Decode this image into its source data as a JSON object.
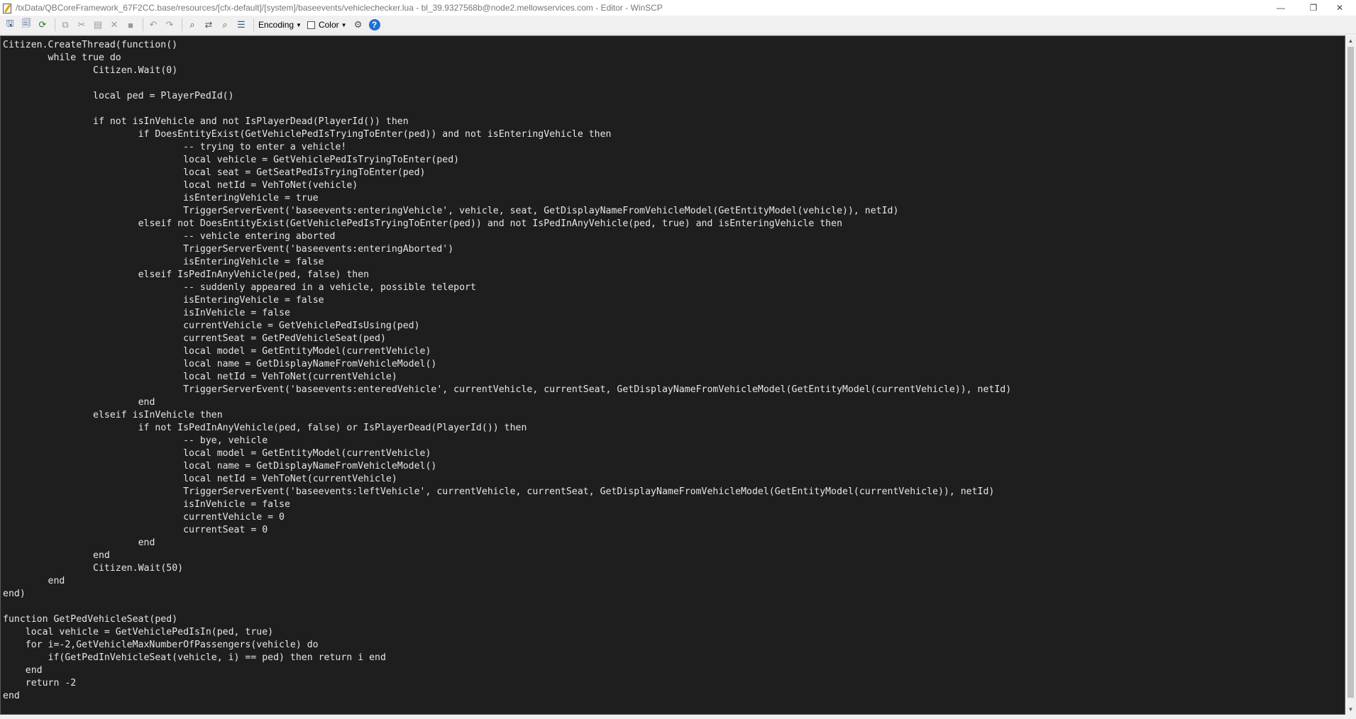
{
  "window": {
    "title": "/txData/QBCoreFramework_67F2CC.base/resources/[cfx-default]/[system]/baseevents/vehiclechecker.lua - bl_39.9327568b@node2.mellowservices.com - Editor - WinSCP",
    "minimize_glyph": "—",
    "restore_glyph": "❐",
    "close_glyph": "✕"
  },
  "toolbar": {
    "encoding_label": "Encoding",
    "color_label": "Color",
    "help_label": "?",
    "icons": [
      "save-icon",
      "save-all-icon",
      "reload-icon",
      "copy-icon",
      "cut-icon",
      "paste-icon",
      "delete-icon",
      "select-all-icon",
      "undo-icon",
      "redo-icon",
      "find-icon",
      "replace-icon",
      "find-next-icon",
      "goto-line-icon",
      "settings-icon",
      "help-icon"
    ]
  },
  "editor": {
    "content": "Citizen.CreateThread(function()\n\twhile true do\n\t\tCitizen.Wait(0)\n\n\t\tlocal ped = PlayerPedId()\n\n\t\tif not isInVehicle and not IsPlayerDead(PlayerId()) then\n\t\t\tif DoesEntityExist(GetVehiclePedIsTryingToEnter(ped)) and not isEnteringVehicle then\n\t\t\t\t-- trying to enter a vehicle!\n\t\t\t\tlocal vehicle = GetVehiclePedIsTryingToEnter(ped)\n\t\t\t\tlocal seat = GetSeatPedIsTryingToEnter(ped)\n\t\t\t\tlocal netId = VehToNet(vehicle)\n\t\t\t\tisEnteringVehicle = true\n\t\t\t\tTriggerServerEvent('baseevents:enteringVehicle', vehicle, seat, GetDisplayNameFromVehicleModel(GetEntityModel(vehicle)), netId)\n\t\t\telseif not DoesEntityExist(GetVehiclePedIsTryingToEnter(ped)) and not IsPedInAnyVehicle(ped, true) and isEnteringVehicle then\n\t\t\t\t-- vehicle entering aborted\n\t\t\t\tTriggerServerEvent('baseevents:enteringAborted')\n\t\t\t\tisEnteringVehicle = false\n\t\t\telseif IsPedInAnyVehicle(ped, false) then\n\t\t\t\t-- suddenly appeared in a vehicle, possible teleport\n\t\t\t\tisEnteringVehicle = false\n\t\t\t\tisInVehicle = false\n\t\t\t\tcurrentVehicle = GetVehiclePedIsUsing(ped)\n\t\t\t\tcurrentSeat = GetPedVehicleSeat(ped)\n\t\t\t\tlocal model = GetEntityModel(currentVehicle)\n\t\t\t\tlocal name = GetDisplayNameFromVehicleModel()\n\t\t\t\tlocal netId = VehToNet(currentVehicle)\n\t\t\t\tTriggerServerEvent('baseevents:enteredVehicle', currentVehicle, currentSeat, GetDisplayNameFromVehicleModel(GetEntityModel(currentVehicle)), netId)\n\t\t\tend\n\t\telseif isInVehicle then\n\t\t\tif not IsPedInAnyVehicle(ped, false) or IsPlayerDead(PlayerId()) then\n\t\t\t\t-- bye, vehicle\n\t\t\t\tlocal model = GetEntityModel(currentVehicle)\n\t\t\t\tlocal name = GetDisplayNameFromVehicleModel()\n\t\t\t\tlocal netId = VehToNet(currentVehicle)\n\t\t\t\tTriggerServerEvent('baseevents:leftVehicle', currentVehicle, currentSeat, GetDisplayNameFromVehicleModel(GetEntityModel(currentVehicle)), netId)\n\t\t\t\tisInVehicle = false\n\t\t\t\tcurrentVehicle = 0\n\t\t\t\tcurrentSeat = 0\n\t\t\tend\n\t\tend\n\t\tCitizen.Wait(50)\n\tend\nend)\n\nfunction GetPedVehicleSeat(ped)\n    local vehicle = GetVehiclePedIsIn(ped, true)\n    for i=-2,GetVehicleMaxNumberOfPassengers(vehicle) do\n        if(GetPedInVehicleSeat(vehicle, i) == ped) then return i end\n    end\n    return -2\nend"
  }
}
